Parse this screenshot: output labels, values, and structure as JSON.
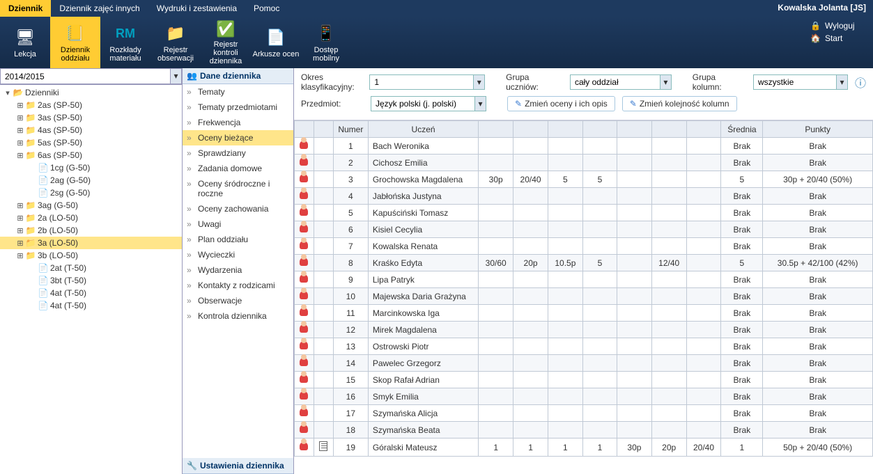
{
  "user": {
    "name": "Kowalska Jolanta [JS]"
  },
  "top_tabs": [
    {
      "label": "Dziennik",
      "active": true
    },
    {
      "label": "Dziennik zajęć innych",
      "active": false
    },
    {
      "label": "Wydruki i zestawienia",
      "active": false
    },
    {
      "label": "Pomoc",
      "active": false
    }
  ],
  "logout_label": "Wyloguj",
  "start_label": "Start",
  "toolbar": [
    {
      "label": "Lekcja",
      "icon": "board",
      "active": false,
      "name": "lekcja"
    },
    {
      "label": "Dziennik oddziału",
      "icon": "book",
      "active": true,
      "name": "dziennik-oddzialu"
    },
    {
      "label": "Rozkłady materiału",
      "icon": "rm",
      "active": false,
      "name": "rozklady-materialu"
    },
    {
      "label": "Rejestr obserwacji",
      "icon": "folder-person",
      "active": false,
      "name": "rejestr-obserwacji"
    },
    {
      "label": "Rejestr kontroli dziennika",
      "icon": "check-doc",
      "active": false,
      "name": "rejestr-kontroli"
    },
    {
      "label": "Arkusze ocen",
      "icon": "sheet-pen",
      "active": false,
      "name": "arkusze-ocen"
    },
    {
      "label": "Dostęp mobilny",
      "icon": "mobile",
      "active": false,
      "name": "dostep-mobilny"
    }
  ],
  "school_year": "2014/2015",
  "tree": {
    "root_label": "Dzienniki",
    "items": [
      {
        "label": "2as (SP-50)",
        "type": "folder",
        "expandable": true,
        "indent": 1
      },
      {
        "label": "3as (SP-50)",
        "type": "folder",
        "expandable": true,
        "indent": 1
      },
      {
        "label": "4as (SP-50)",
        "type": "folder",
        "expandable": true,
        "indent": 1
      },
      {
        "label": "5as (SP-50)",
        "type": "folder",
        "expandable": true,
        "indent": 1
      },
      {
        "label": "6as (SP-50)",
        "type": "folder",
        "expandable": true,
        "indent": 1
      },
      {
        "label": "1cg (G-50)",
        "type": "page",
        "expandable": false,
        "indent": 2
      },
      {
        "label": "2ag (G-50)",
        "type": "page",
        "expandable": false,
        "indent": 2
      },
      {
        "label": "2sg (G-50)",
        "type": "page",
        "expandable": false,
        "indent": 2
      },
      {
        "label": "3ag (G-50)",
        "type": "folder",
        "expandable": true,
        "indent": 1
      },
      {
        "label": "2a (LO-50)",
        "type": "folder",
        "expandable": true,
        "indent": 1
      },
      {
        "label": "2b (LO-50)",
        "type": "folder",
        "expandable": true,
        "indent": 1
      },
      {
        "label": "3a (LO-50)",
        "type": "folder",
        "expandable": true,
        "indent": 1,
        "selected": true
      },
      {
        "label": "3b (LO-50)",
        "type": "folder",
        "expandable": true,
        "indent": 1
      },
      {
        "label": "2at (T-50)",
        "type": "page",
        "expandable": false,
        "indent": 2
      },
      {
        "label": "3bt (T-50)",
        "type": "page",
        "expandable": false,
        "indent": 2
      },
      {
        "label": "4at (T-50)",
        "type": "page",
        "expandable": false,
        "indent": 2
      },
      {
        "label": "4at (T-50)",
        "type": "page",
        "expandable": false,
        "indent": 2
      }
    ]
  },
  "mid_panel": {
    "title": "Dane dziennika",
    "items": [
      {
        "label": "Tematy",
        "selected": false
      },
      {
        "label": "Tematy przedmiotami",
        "selected": false
      },
      {
        "label": "Frekwencja",
        "selected": false
      },
      {
        "label": "Oceny bieżące",
        "selected": true
      },
      {
        "label": "Sprawdziany",
        "selected": false
      },
      {
        "label": "Zadania domowe",
        "selected": false
      },
      {
        "label": "Oceny śródroczne i roczne",
        "selected": false
      },
      {
        "label": "Oceny zachowania",
        "selected": false
      },
      {
        "label": "Uwagi",
        "selected": false
      },
      {
        "label": "Plan oddziału",
        "selected": false
      },
      {
        "label": "Wycieczki",
        "selected": false
      },
      {
        "label": "Wydarzenia",
        "selected": false
      },
      {
        "label": "Kontakty z rodzicami",
        "selected": false
      },
      {
        "label": "Obserwacje",
        "selected": false
      },
      {
        "label": "Kontrola dziennika",
        "selected": false
      }
    ],
    "footer_title": "Ustawienia dziennika"
  },
  "filters": {
    "okres_label": "Okres klasyfikacyjny:",
    "okres_value": "1",
    "grupa_uczniow_label": "Grupa uczniów:",
    "grupa_uczniow_value": "cały oddział",
    "grupa_kolumn_label": "Grupa kolumn:",
    "grupa_kolumn_value": "wszystkie",
    "przedmiot_label": "Przedmiot:",
    "przedmiot_value": "Język polski (j. polski)",
    "btn_zmien_oceny": "Zmień oceny i ich opis",
    "btn_zmien_kolumn": "Zmień kolejność kolumn"
  },
  "grid": {
    "headers": {
      "numer": "Numer",
      "uczen": "Uczeń",
      "srednia": "Średnia",
      "punkty": "Punkty"
    },
    "rows": [
      {
        "num": 1,
        "name": "Bach Weronika",
        "c": [
          "",
          "",
          "",
          "",
          "",
          "",
          ""
        ],
        "avg": "Brak",
        "pts": "Brak",
        "doc": false
      },
      {
        "num": 2,
        "name": "Cichosz Emilia",
        "c": [
          "",
          "",
          "",
          "",
          "",
          "",
          ""
        ],
        "avg": "Brak",
        "pts": "Brak",
        "doc": false
      },
      {
        "num": 3,
        "name": "Grochowska Magdalena",
        "c": [
          "30p",
          "20/40",
          "5",
          "5",
          "",
          "",
          ""
        ],
        "avg": "5",
        "pts": "30p + 20/40 (50%)",
        "doc": false
      },
      {
        "num": 4,
        "name": "Jabłońska Justyna",
        "c": [
          "",
          "",
          "",
          "",
          "",
          "",
          ""
        ],
        "avg": "Brak",
        "pts": "Brak",
        "doc": false
      },
      {
        "num": 5,
        "name": "Kapuściński Tomasz",
        "c": [
          "",
          "",
          "",
          "",
          "",
          "",
          ""
        ],
        "avg": "Brak",
        "pts": "Brak",
        "doc": false
      },
      {
        "num": 6,
        "name": "Kisiel Cecylia",
        "c": [
          "",
          "",
          "",
          "",
          "",
          "",
          ""
        ],
        "avg": "Brak",
        "pts": "Brak",
        "doc": false
      },
      {
        "num": 7,
        "name": "Kowalska Renata",
        "c": [
          "",
          "",
          "",
          "",
          "",
          "",
          ""
        ],
        "avg": "Brak",
        "pts": "Brak",
        "doc": false
      },
      {
        "num": 8,
        "name": "Kraśko Edyta",
        "c": [
          "30/60",
          "20p",
          "10.5p",
          "5",
          "",
          "12/40",
          ""
        ],
        "avg": "5",
        "pts": "30.5p + 42/100 (42%)",
        "doc": false
      },
      {
        "num": 9,
        "name": "Lipa Patryk",
        "c": [
          "",
          "",
          "",
          "",
          "",
          "",
          ""
        ],
        "avg": "Brak",
        "pts": "Brak",
        "doc": false
      },
      {
        "num": 10,
        "name": "Majewska Daria Grażyna",
        "c": [
          "",
          "",
          "",
          "",
          "",
          "",
          ""
        ],
        "avg": "Brak",
        "pts": "Brak",
        "doc": false
      },
      {
        "num": 11,
        "name": "Marcinkowska Iga",
        "c": [
          "",
          "",
          "",
          "",
          "",
          "",
          ""
        ],
        "avg": "Brak",
        "pts": "Brak",
        "doc": false
      },
      {
        "num": 12,
        "name": "Mirek Magdalena",
        "c": [
          "",
          "",
          "",
          "",
          "",
          "",
          ""
        ],
        "avg": "Brak",
        "pts": "Brak",
        "doc": false
      },
      {
        "num": 13,
        "name": "Ostrowski Piotr",
        "c": [
          "",
          "",
          "",
          "",
          "",
          "",
          ""
        ],
        "avg": "Brak",
        "pts": "Brak",
        "doc": false
      },
      {
        "num": 14,
        "name": "Pawelec Grzegorz",
        "c": [
          "",
          "",
          "",
          "",
          "",
          "",
          ""
        ],
        "avg": "Brak",
        "pts": "Brak",
        "doc": false
      },
      {
        "num": 15,
        "name": "Skop Rafał Adrian",
        "c": [
          "",
          "",
          "",
          "",
          "",
          "",
          ""
        ],
        "avg": "Brak",
        "pts": "Brak",
        "doc": false
      },
      {
        "num": 16,
        "name": "Smyk Emilia",
        "c": [
          "",
          "",
          "",
          "",
          "",
          "",
          ""
        ],
        "avg": "Brak",
        "pts": "Brak",
        "doc": false
      },
      {
        "num": 17,
        "name": "Szymańska Alicja",
        "c": [
          "",
          "",
          "",
          "",
          "",
          "",
          ""
        ],
        "avg": "Brak",
        "pts": "Brak",
        "doc": false
      },
      {
        "num": 18,
        "name": "Szymańska Beata",
        "c": [
          "",
          "",
          "",
          "",
          "",
          "",
          ""
        ],
        "avg": "Brak",
        "pts": "Brak",
        "doc": false
      },
      {
        "num": 19,
        "name": "Góralski Mateusz",
        "c": [
          "1",
          "1",
          "1",
          "1",
          "30p",
          "20p",
          "20/40"
        ],
        "avg": "1",
        "pts": "50p + 20/40 (50%)",
        "doc": true
      }
    ]
  }
}
